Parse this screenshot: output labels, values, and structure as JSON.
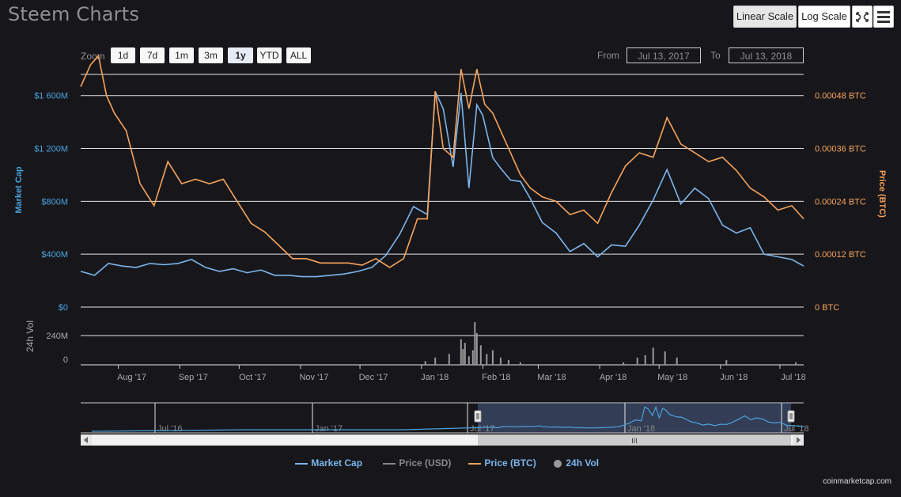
{
  "app": {
    "title": "Steem Charts",
    "credit": "coinmarketcap.com"
  },
  "toolbar": {
    "linear_label": "Linear Scale",
    "log_label": "Log Scale",
    "fullscreen_icon": "fullscreen-icon",
    "menu_icon": "menu-icon",
    "active_scale": "Linear Scale"
  },
  "zoom": {
    "label": "Zoom",
    "buttons": [
      "1d",
      "7d",
      "1m",
      "3m",
      "1y",
      "YTD",
      "ALL"
    ],
    "selected": "1y"
  },
  "range": {
    "from_label": "From",
    "from_value": "Jul 13, 2017",
    "to_label": "To",
    "to_value": "Jul 13, 2018"
  },
  "legend": {
    "items": [
      {
        "label": "Market Cap",
        "color": "#7cb5ec",
        "type": "line",
        "active": true
      },
      {
        "label": "Price (USD)",
        "color": "#888888",
        "type": "line",
        "active": false
      },
      {
        "label": "Price (BTC)",
        "color": "#f7a35c",
        "type": "line",
        "active": true
      },
      {
        "label": "24h Vol",
        "color": "#999999",
        "type": "dot",
        "active": true
      }
    ]
  },
  "chart_data": [
    {
      "type": "line",
      "title": "",
      "x_range": [
        "2017-07-13",
        "2018-07-13"
      ],
      "xticks": [
        "Aug '17",
        "Sep '17",
        "Oct '17",
        "Nov '17",
        "Dec '17",
        "Jan '18",
        "Feb '18",
        "Mar '18",
        "Apr '18",
        "May '18",
        "Jun '18",
        "Jul '18"
      ],
      "left_axis": {
        "label": "Market Cap",
        "ticks": [
          "$0",
          "$400M",
          "$800M",
          "$1 200M",
          "$1 600M"
        ],
        "range": [
          0,
          2000
        ],
        "unit": "M USD",
        "color": "#4aa3df"
      },
      "right_axis": {
        "label": "Price (BTC)",
        "ticks": [
          "0 BTC",
          "0.00012 BTC",
          "0.00024 BTC",
          "0.00036 BTC",
          "0.00048 BTC"
        ],
        "range": [
          0,
          0.0006
        ],
        "color": "#f7a35c"
      },
      "grid": true,
      "series": [
        {
          "name": "Market Cap",
          "axis": "left",
          "color": "#7cb5ec",
          "x": [
            "2017-07-13",
            "2017-07-20",
            "2017-07-27",
            "2017-08-03",
            "2017-08-10",
            "2017-08-17",
            "2017-08-24",
            "2017-08-31",
            "2017-09-07",
            "2017-09-14",
            "2017-09-21",
            "2017-09-28",
            "2017-10-05",
            "2017-10-12",
            "2017-10-19",
            "2017-10-26",
            "2017-11-02",
            "2017-11-09",
            "2017-11-16",
            "2017-11-23",
            "2017-11-30",
            "2017-12-07",
            "2017-12-14",
            "2017-12-21",
            "2017-12-28",
            "2018-01-04",
            "2018-01-08",
            "2018-01-12",
            "2018-01-17",
            "2018-01-21",
            "2018-01-25",
            "2018-01-29",
            "2018-02-01",
            "2018-02-06",
            "2018-02-10",
            "2018-02-15",
            "2018-02-20",
            "2018-02-25",
            "2018-03-03",
            "2018-03-10",
            "2018-03-17",
            "2018-03-24",
            "2018-03-31",
            "2018-04-07",
            "2018-04-14",
            "2018-04-21",
            "2018-04-28",
            "2018-05-05",
            "2018-05-12",
            "2018-05-19",
            "2018-05-26",
            "2018-06-02",
            "2018-06-09",
            "2018-06-16",
            "2018-06-23",
            "2018-06-30",
            "2018-07-07",
            "2018-07-13"
          ],
          "values": [
            270,
            240,
            330,
            310,
            300,
            330,
            320,
            330,
            360,
            300,
            270,
            290,
            260,
            280,
            240,
            240,
            230,
            230,
            240,
            250,
            270,
            300,
            390,
            550,
            760,
            700,
            1630,
            1500,
            1060,
            1620,
            900,
            1530,
            1450,
            1130,
            1050,
            960,
            950,
            820,
            640,
            560,
            420,
            480,
            380,
            470,
            460,
            620,
            810,
            1040,
            780,
            900,
            820,
            620,
            560,
            600,
            400,
            380,
            360,
            310
          ]
        },
        {
          "name": "Price (BTC)",
          "axis": "right",
          "color": "#f7a35c",
          "x": [
            "2017-07-13",
            "2017-07-18",
            "2017-07-22",
            "2017-07-26",
            "2017-07-30",
            "2017-08-05",
            "2017-08-12",
            "2017-08-19",
            "2017-08-26",
            "2017-09-02",
            "2017-09-09",
            "2017-09-16",
            "2017-09-23",
            "2017-09-30",
            "2017-10-07",
            "2017-10-14",
            "2017-10-21",
            "2017-10-28",
            "2017-11-04",
            "2017-11-11",
            "2017-11-18",
            "2017-11-25",
            "2017-12-02",
            "2017-12-09",
            "2017-12-16",
            "2017-12-23",
            "2017-12-30",
            "2018-01-04",
            "2018-01-08",
            "2018-01-12",
            "2018-01-17",
            "2018-01-21",
            "2018-01-25",
            "2018-01-29",
            "2018-02-02",
            "2018-02-06",
            "2018-02-10",
            "2018-02-15",
            "2018-02-20",
            "2018-02-25",
            "2018-03-03",
            "2018-03-10",
            "2018-03-17",
            "2018-03-24",
            "2018-03-31",
            "2018-04-07",
            "2018-04-14",
            "2018-04-21",
            "2018-04-28",
            "2018-05-05",
            "2018-05-12",
            "2018-05-19",
            "2018-05-26",
            "2018-06-02",
            "2018-06-09",
            "2018-06-16",
            "2018-06-23",
            "2018-06-30",
            "2018-07-07",
            "2018-07-13"
          ],
          "values": [
            0.0005,
            0.00055,
            0.00057,
            0.00048,
            0.00044,
            0.0004,
            0.00028,
            0.00023,
            0.00033,
            0.00028,
            0.00029,
            0.00028,
            0.00029,
            0.00024,
            0.00019,
            0.00017,
            0.00014,
            0.00011,
            0.00011,
            0.0001,
            0.0001,
            0.0001,
            9.5e-05,
            0.00011,
            9e-05,
            0.00011,
            0.0002,
            0.0002,
            0.00049,
            0.00036,
            0.00034,
            0.00054,
            0.00045,
            0.00054,
            0.00046,
            0.00044,
            0.0004,
            0.00035,
            0.0003,
            0.00027,
            0.00025,
            0.00024,
            0.00021,
            0.00022,
            0.00019,
            0.00026,
            0.00032,
            0.00035,
            0.00034,
            0.00043,
            0.00037,
            0.00035,
            0.00033,
            0.00034,
            0.00031,
            0.00027,
            0.00025,
            0.00022,
            0.00023,
            0.0002
          ]
        }
      ]
    },
    {
      "type": "bar",
      "title": "",
      "y_label": "24h Vol",
      "y_ticks": [
        "0",
        "240M"
      ],
      "ylim": [
        0,
        400
      ],
      "unit": "M USD",
      "color": "#999999",
      "x": [
        "2018-01-03",
        "2018-01-08",
        "2018-01-15",
        "2018-01-21",
        "2018-01-22",
        "2018-01-23",
        "2018-01-25",
        "2018-01-27",
        "2018-01-28",
        "2018-01-29",
        "2018-01-31",
        "2018-02-03",
        "2018-02-06",
        "2018-02-10",
        "2018-02-14",
        "2018-02-20",
        "2018-04-13",
        "2018-04-20",
        "2018-04-24",
        "2018-04-28",
        "2018-05-04",
        "2018-05-10",
        "2018-06-04",
        "2018-07-09"
      ],
      "values": [
        30,
        60,
        90,
        210,
        130,
        180,
        70,
        120,
        350,
        260,
        160,
        90,
        120,
        60,
        40,
        20,
        20,
        60,
        80,
        140,
        110,
        60,
        40,
        20
      ]
    }
  ],
  "navigator": {
    "ticks": [
      "Jul '16",
      "Jan '17",
      "Jul '17",
      "Jan '18",
      "Jul '18"
    ],
    "scrollbar_grip": "III"
  }
}
